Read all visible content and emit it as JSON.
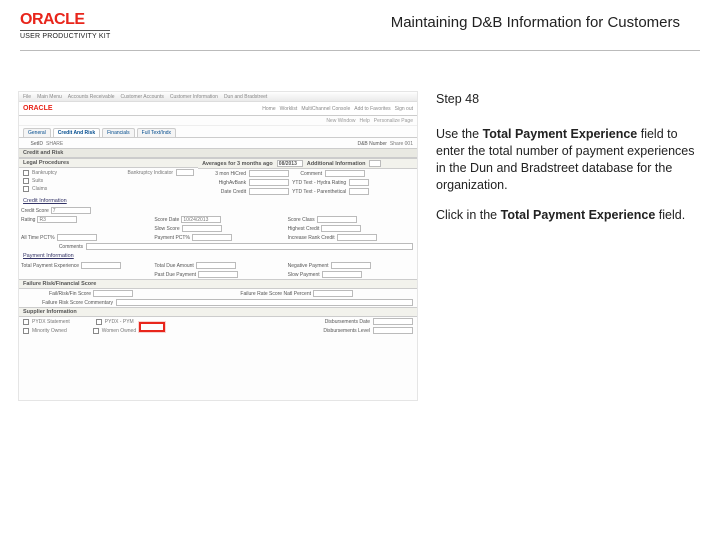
{
  "header": {
    "brand": "ORACLE",
    "subBrand": "USER PRODUCTIVITY KIT",
    "title": "Maintaining D&B Information for Customers"
  },
  "instructions": {
    "step": "Step 48",
    "p1_pre": "Use the ",
    "p1_bold": "Total Payment Experience",
    "p1_post": " field to enter the total number of payment experiences in the Dun and Bradstreet database for the organization.",
    "p2_pre": "Click in the ",
    "p2_bold": "Total Payment Experience",
    "p2_post": " field."
  },
  "shot": {
    "topbar": [
      "File",
      "Main Menu",
      "Accounts Receivable",
      "Customer Accounts",
      "Customer Information",
      "Dun and Bradstreet"
    ],
    "brand": "ORACLE",
    "brandLinks": [
      "Home",
      "Worklist",
      "MultiChannel Console",
      "Add to Favorites",
      "Sign out"
    ],
    "follow": [
      "New Window",
      "Help",
      "Personalize Page"
    ],
    "tabs": [
      "General",
      "Credit And Risk",
      "Financials",
      "Full Text/Indx"
    ],
    "activeTab": 1,
    "infoRow": {
      "l": "SetID",
      "v": "SHARE",
      "l2": "D&B Number",
      "v2": "Share 001"
    },
    "sectionCreditRisk": "Credit and Risk",
    "legalHead": "Legal Procedures",
    "legalLeft": [
      {
        "chk": true,
        "label": "Bankruptcy",
        "sub": "Bankruptcy Indicator"
      },
      {
        "chk": false,
        "label": "Suits"
      },
      {
        "chk": false,
        "label": "Claims"
      }
    ],
    "avgHead": "Averages for 3 months ago",
    "avgDate": "08/2013",
    "avgAddl": "Additional Information",
    "avgRows": [
      {
        "l": "3 mon HiCred",
        "r": "Comment"
      },
      {
        "l": "HighAvBank",
        "r": "YTD Text - Hydra Rating"
      },
      {
        "l": "Date Credit",
        "r": "YTD Text - Parenthetical"
      }
    ],
    "creditInfoHead": "Credit Information",
    "creditRows": [
      {
        "l1": "Credit Score",
        "v1": "7",
        "l2": "",
        "v2": ""
      },
      {
        "l1": "Rating",
        "v1": "R3",
        "l2": "Score Date",
        "v2": "10/24/2013",
        "l3": "Score Class",
        "v3": ""
      },
      {
        "l1": "",
        "v1": "",
        "l2": "Slow Score",
        "v2": "",
        "l3": "Highest Credit",
        "v3": ""
      },
      {
        "l1": "All Time PCT%",
        "v1": "",
        "l2": "Payment PCT%",
        "v2": "",
        "l3": "Increase Rank Credit",
        "v3": ""
      },
      {
        "l1": "Comments",
        "v1": "",
        "colspan": true
      }
    ],
    "paymentHead": "Payment Information",
    "paymentRows": [
      {
        "l1": "Total Payment Experience",
        "l2": "Total Due Amount",
        "l3": "Negative Payment"
      },
      {
        "l1": "",
        "l2": "Past Due Payment",
        "l3": "Slow Payment"
      }
    ],
    "failureHead": "Failure Risk/Financial Score",
    "failureRows": [
      {
        "l1": "Fail/Risk/Fin Score",
        "l2": "Failure Rate Score Natl Percent"
      },
      {
        "l1": "Failure Risk Score Commentary"
      }
    ],
    "supplierHead": "Supplier Information",
    "supplierRows": [
      {
        "chk1": "PYDX Statement",
        "chk2": "PYDX - PYM",
        "l": "Disbursements Date"
      },
      {
        "chk1": "Minority Owned",
        "chk2": "Women Owned",
        "l": "Disbursements Level"
      }
    ]
  }
}
